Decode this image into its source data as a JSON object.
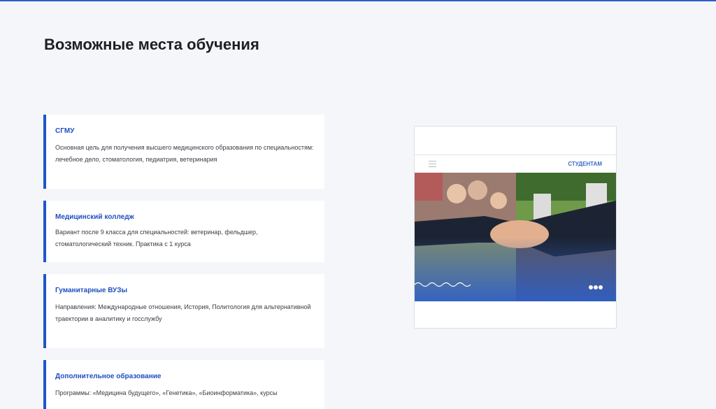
{
  "page": {
    "title": "Возможные места обучения"
  },
  "cards": [
    {
      "title": "СГМУ",
      "text": "Основная цель для получения высшего медицинского образования по специальностям: лечебное дело, стоматология, педиатрия, ветеринария"
    },
    {
      "title": "Медицинский колледж",
      "text": "Вариант после 9 класса для специальностей: ветеринар, фельдшер, стоматологический техник. Практика с 1 курса"
    },
    {
      "title": "Гуманитарные ВУЗы",
      "text": "Направления: Международные отношения, История, Политология для альтернативной траектории в аналитику и госслужбу"
    },
    {
      "title": "Дополнительное образование",
      "text": "Программы: «Медицина будущего», «Генетика», «Биоинформатика», курсы"
    }
  ],
  "preview": {
    "nav_label": "СТУДЕНТАМ",
    "menu_icon": "hamburger-icon"
  },
  "colors": {
    "accent": "#1f55c8",
    "background": "#f5f6f9"
  }
}
